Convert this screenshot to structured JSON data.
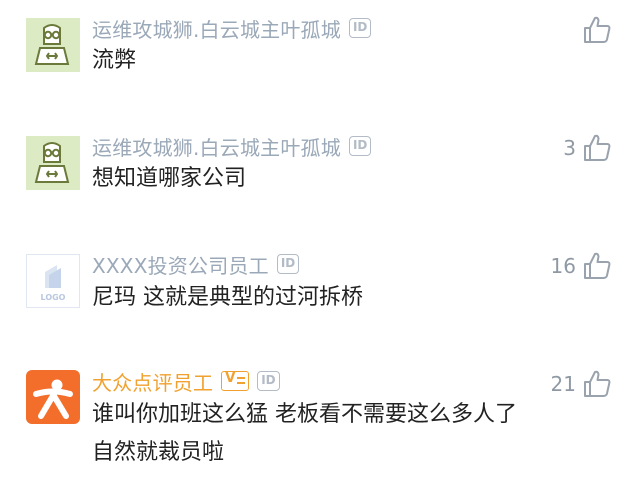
{
  "comments": [
    {
      "author": "运维攻城狮.白云城主叶孤城",
      "id_badge": "ID",
      "text": "流弊",
      "likes": "",
      "avatar_icon": "engineer-avatar-icon"
    },
    {
      "author": "运维攻城狮.白云城主叶孤城",
      "id_badge": "ID",
      "text": "想知道哪家公司",
      "likes": "3",
      "avatar_icon": "engineer-avatar-icon"
    },
    {
      "author": "XXXX投资公司员工",
      "id_badge": "ID",
      "text": "尼玛 这就是典型的过河拆桥",
      "likes": "16",
      "avatar_icon": "company-logo-avatar",
      "avatar_logo_text": "LOGO"
    },
    {
      "author": "大众点评员工",
      "verified_badge": "V",
      "id_badge": "ID",
      "text_line1": "谁叫你加班这么猛 老板看不需要这么多人了",
      "text_line2": "自然就裁员啦",
      "likes": "21",
      "avatar_icon": "dianping-avatar-icon"
    }
  ],
  "colors": {
    "author_gray": "#9aa8b8",
    "author_orange": "#f1a12f",
    "avatar_green": "#dcebc4",
    "dianping_orange": "#f36d2b"
  }
}
